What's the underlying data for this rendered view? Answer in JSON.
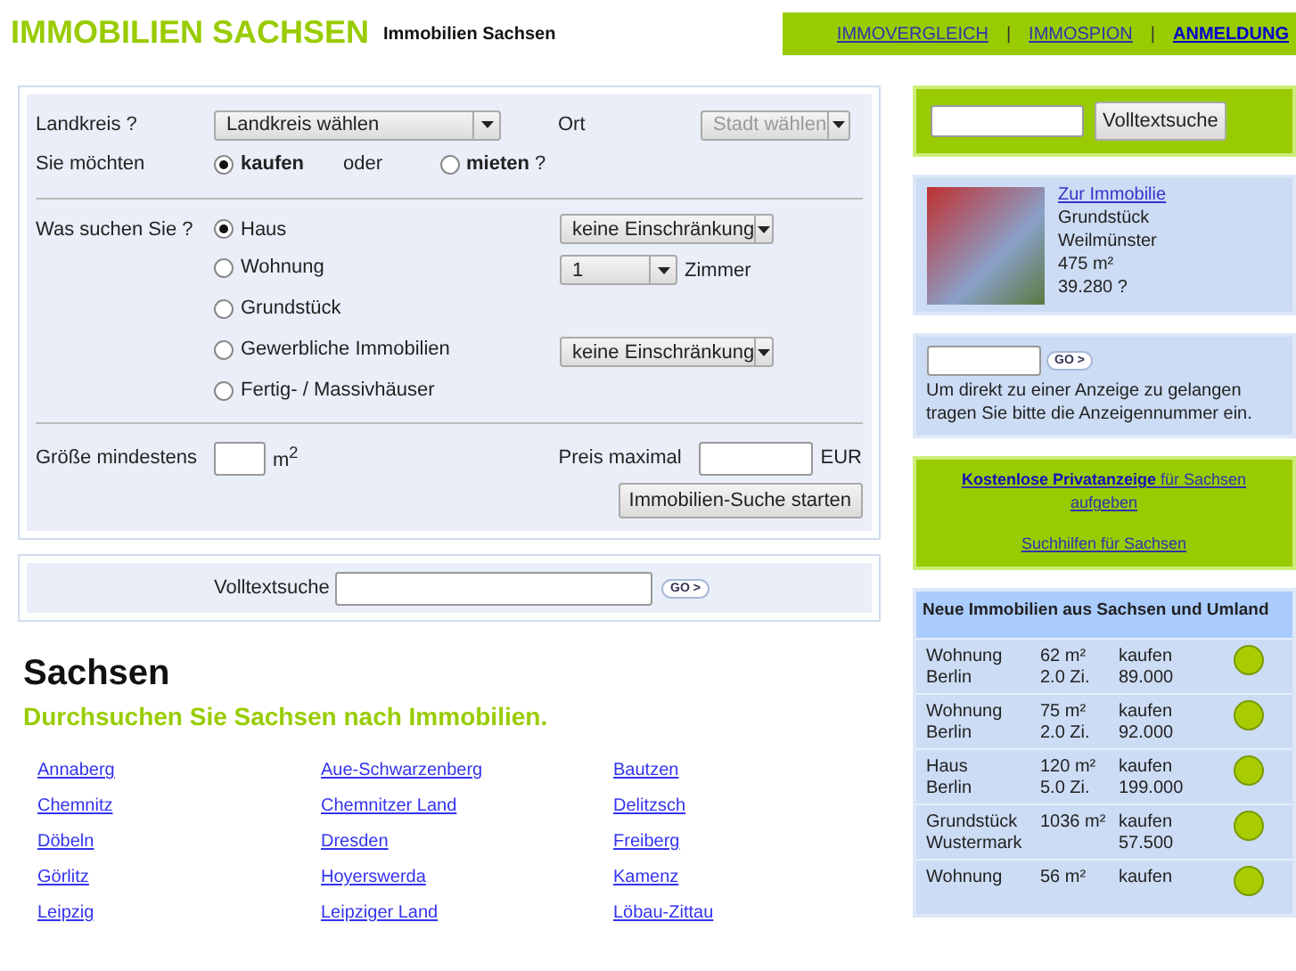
{
  "header": {
    "title": "IMMOBILIEN SACHSEN",
    "subtitle": "Immobilien Sachsen",
    "separator": "|",
    "nav": [
      {
        "label": "IMMOVERGLEICH",
        "emphasized": false
      },
      {
        "label": "IMMOSPION",
        "emphasized": false
      },
      {
        "label": "ANMELDUNG",
        "emphasized": true
      }
    ]
  },
  "search_form": {
    "district": {
      "label": "Landkreis ?",
      "value": "Landkreis wählen"
    },
    "town": {
      "label": "Ort",
      "value": "Stadt wählen",
      "disabled": true
    },
    "intent": {
      "label": "Sie möchten",
      "between": "oder",
      "options": [
        {
          "label": "kaufen",
          "selected": true
        },
        {
          "label": "**mieten** ?",
          "selected": false
        }
      ]
    },
    "property_type": {
      "label": "Was suchen Sie ?",
      "options": [
        {
          "label": "Haus",
          "selected": true,
          "filter": "keine Einschränkung"
        },
        {
          "label": "Wohnung",
          "selected": false,
          "filter": "1",
          "unit": "Zimmer"
        },
        {
          "label": "Grundstück",
          "selected": false
        },
        {
          "label": "Gewerbliche Immobilien",
          "selected": false,
          "filter": "keine Einschränkung"
        },
        {
          "label": "Fertig- / Massivhäuser",
          "selected": false
        }
      ]
    },
    "size": {
      "label": "Größe mindestens",
      "unit": "m$^{2}$"
    },
    "price": {
      "label": "Preis maximal",
      "unit": "EUR"
    },
    "submit": "Immobilien-Suche starten"
  },
  "fulltext_bar": {
    "label": "Volltextsuche",
    "go": "GO >"
  },
  "region": {
    "heading": "Sachsen",
    "subheading": "Durchsuchen Sie Sachsen nach Immobilien.",
    "links": [
      "Annaberg",
      "Aue-Schwarzenberg",
      "Bautzen",
      "Chemnitz",
      "Chemnitzer Land",
      "Delitzsch",
      "Döbeln",
      "Dresden",
      "Freiberg",
      "Görlitz",
      "Hoyerswerda",
      "Kamenz",
      "Leipzig",
      "Leipziger Land",
      "Löbau-Zittau"
    ]
  },
  "sidebar": {
    "fulltext": {
      "button": "Volltextsuche"
    },
    "featured": {
      "link": "Zur Immobilie",
      "lines": [
        "Grundstück",
        "Weilmünster",
        "475 m²",
        "39.280 ?"
      ]
    },
    "ad_number": {
      "go": "GO >",
      "hint": "Um direkt zu einer Anzeige zu gelangen tragen Sie bitte die Anzeigennummer ein."
    },
    "links": [
      "**Kostenlose Privatanzeige** für Sachsen aufgeben",
      "Suchhilfen für Sachsen"
    ],
    "listings": {
      "title": "Neue Immobilien aus Sachsen und Umland",
      "rows": [
        {
          "type": "Wohnung",
          "city": "Berlin",
          "area": "62 m²",
          "rooms": "2.0 Zi.",
          "deal": "kaufen",
          "price": "89.000"
        },
        {
          "type": "Wohnung",
          "city": "Berlin",
          "area": "75 m²",
          "rooms": "2.0 Zi.",
          "deal": "kaufen",
          "price": "92.000"
        },
        {
          "type": "Haus",
          "city": "Berlin",
          "area": "120 m²",
          "rooms": "5.0 Zi.",
          "deal": "kaufen",
          "price": "199.000"
        },
        {
          "type": "Grundstück",
          "city": "Wustermark",
          "area": "1036 m²",
          "deal": "kaufen",
          "price": "57.500"
        },
        {
          "type": "Wohnung",
          "area": "56 m²",
          "deal": "kaufen"
        }
      ]
    }
  }
}
